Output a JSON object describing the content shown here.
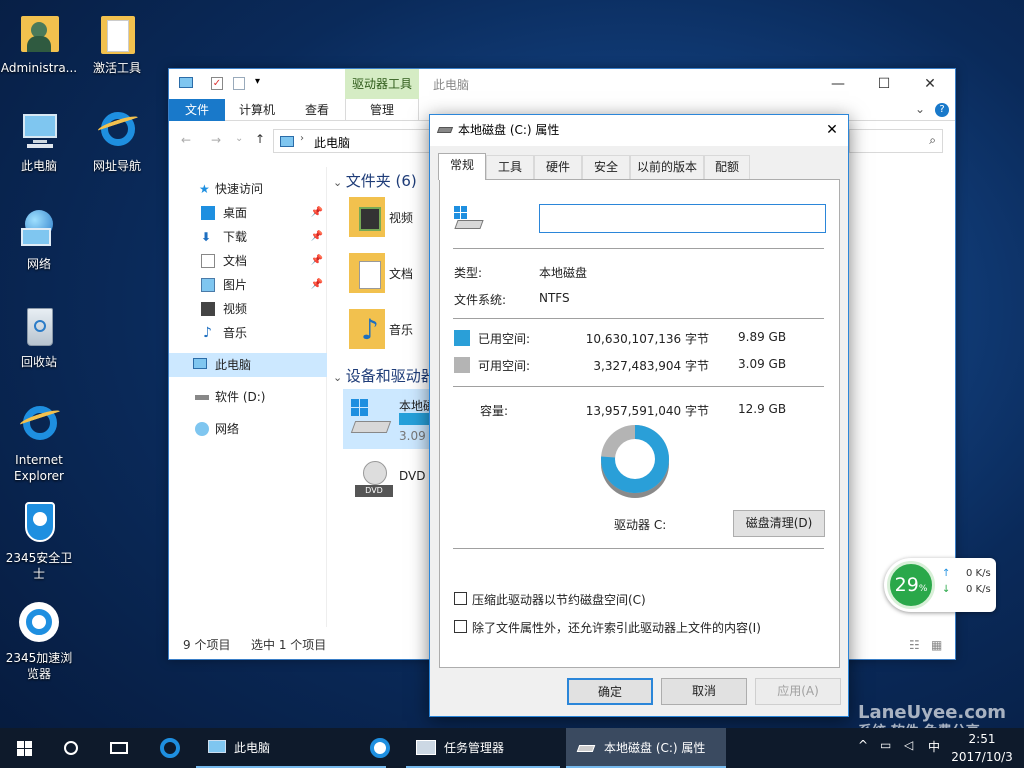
{
  "desktop": {
    "icons": [
      {
        "label": "Administra..."
      },
      {
        "label": "激活工具"
      },
      {
        "label": "此电脑"
      },
      {
        "label": "网址导航"
      },
      {
        "label": "网络"
      },
      {
        "label": "回收站"
      },
      {
        "label": "Internet Explorer"
      },
      {
        "label": "2345安全卫士"
      },
      {
        "label": "2345加速浏览器"
      }
    ]
  },
  "explorer": {
    "title": "此电脑",
    "context_group": "驱动器工具",
    "ribbon_tabs": [
      "文件",
      "计算机",
      "查看",
      "管理"
    ],
    "address": "此电脑",
    "nav": [
      {
        "label": "快速访问"
      },
      {
        "label": "桌面"
      },
      {
        "label": "下载"
      },
      {
        "label": "文档"
      },
      {
        "label": "图片"
      },
      {
        "label": "视频"
      },
      {
        "label": "音乐"
      },
      {
        "label": "此电脑"
      },
      {
        "label": "软件 (D:)"
      },
      {
        "label": "网络"
      }
    ],
    "folders_header": "文件夹 (6)",
    "folders": [
      {
        "label": "视频"
      },
      {
        "label": "文档"
      },
      {
        "label": "音乐"
      }
    ],
    "devices_header": "设备和驱动器",
    "drives": [
      {
        "label": "本地磁",
        "size": "3.09"
      },
      {
        "label": "DVD"
      }
    ],
    "status_items": "9 个项目",
    "status_selected": "选中 1 个项目"
  },
  "dialog": {
    "title": "本地磁盘 (C:) 属性",
    "tabs": [
      "常规",
      "工具",
      "硬件",
      "安全",
      "以前的版本",
      "配额"
    ],
    "name_value": "",
    "type_label": "类型:",
    "type_value": "本地磁盘",
    "fs_label": "文件系统:",
    "fs_value": "NTFS",
    "used_label": "已用空间:",
    "used_bytes": "10,630,107,136 字节",
    "used_gb": "9.89 GB",
    "free_label": "可用空间:",
    "free_bytes": "3,327,483,904 字节",
    "free_gb": "3.09 GB",
    "cap_label": "容量:",
    "cap_bytes": "13,957,591,040 字节",
    "cap_gb": "12.9 GB",
    "used_fraction": 0.762,
    "used_color": "#2a9fd8",
    "free_color": "#b4b4b4",
    "drive_label": "驱动器 C:",
    "cleanup_btn": "磁盘清理(D)",
    "compress_label": "压缩此驱动器以节约磁盘空间(C)",
    "index_label": "除了文件属性外，还允许索引此驱动器上文件的内容(I)",
    "ok": "确定",
    "cancel": "取消",
    "apply": "应用(A)"
  },
  "widget": {
    "percent": "29",
    "unit": "%",
    "up": "0 K/s",
    "down": "0 K/s"
  },
  "taskbar": {
    "items": [
      {
        "label": "此电脑"
      },
      {
        "label": "任务管理器"
      },
      {
        "label": "本地磁盘 (C:) 属性"
      }
    ],
    "time": "2:51",
    "date": "2017/10/3",
    "ime": "中"
  },
  "watermark": {
    "line1": "LaneUyee.com",
    "line2": "系统 软件 免费分享"
  }
}
